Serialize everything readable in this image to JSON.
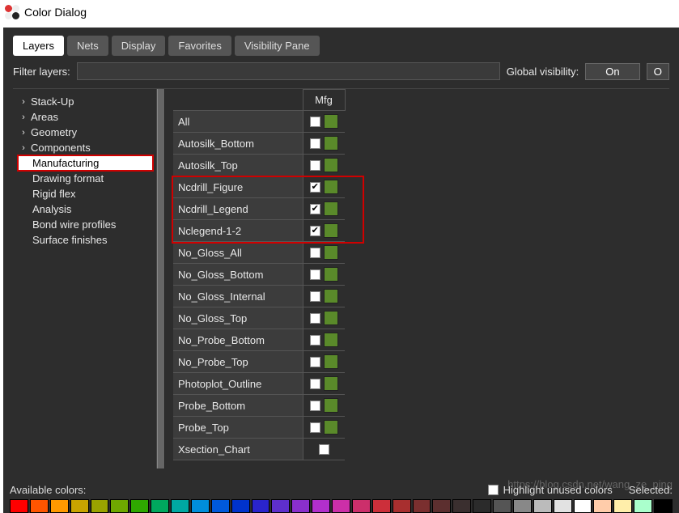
{
  "window": {
    "title": "Color Dialog"
  },
  "tabs": [
    {
      "label": "Layers",
      "active": true
    },
    {
      "label": "Nets"
    },
    {
      "label": "Display"
    },
    {
      "label": "Favorites"
    },
    {
      "label": "Visibility Pane"
    }
  ],
  "filter": {
    "label": "Filter layers:",
    "value": ""
  },
  "global_visibility": {
    "label": "Global visibility:",
    "button": "On"
  },
  "tree": {
    "items": [
      {
        "label": "Stack-Up",
        "expandable": true
      },
      {
        "label": "Areas",
        "expandable": true
      },
      {
        "label": "Geometry",
        "expandable": true
      },
      {
        "label": "Components",
        "expandable": true
      },
      {
        "label": "Manufacturing",
        "expandable": false,
        "selected": true
      },
      {
        "label": "Drawing format",
        "expandable": false
      },
      {
        "label": "Rigid flex",
        "expandable": false
      },
      {
        "label": "Analysis",
        "expandable": false
      },
      {
        "label": "Bond wire profiles",
        "expandable": false
      },
      {
        "label": "Surface finishes",
        "expandable": false
      }
    ]
  },
  "grid": {
    "header_mfg": "Mfg",
    "rows": [
      {
        "name": "All",
        "checked": false,
        "swatch": true
      },
      {
        "name": "Autosilk_Bottom",
        "checked": false,
        "swatch": true
      },
      {
        "name": "Autosilk_Top",
        "checked": false,
        "swatch": true
      },
      {
        "name": "Ncdrill_Figure",
        "checked": true,
        "swatch": true
      },
      {
        "name": "Ncdrill_Legend",
        "checked": true,
        "swatch": true
      },
      {
        "name": "Nclegend-1-2",
        "checked": true,
        "swatch": true
      },
      {
        "name": "No_Gloss_All",
        "checked": false,
        "swatch": true
      },
      {
        "name": "No_Gloss_Bottom",
        "checked": false,
        "swatch": true
      },
      {
        "name": "No_Gloss_Internal",
        "checked": false,
        "swatch": true
      },
      {
        "name": "No_Gloss_Top",
        "checked": false,
        "swatch": true
      },
      {
        "name": "No_Probe_Bottom",
        "checked": false,
        "swatch": true
      },
      {
        "name": "No_Probe_Top",
        "checked": false,
        "swatch": true
      },
      {
        "name": "Photoplot_Outline",
        "checked": false,
        "swatch": true
      },
      {
        "name": "Probe_Bottom",
        "checked": false,
        "swatch": true
      },
      {
        "name": "Probe_Top",
        "checked": false,
        "swatch": true
      },
      {
        "name": "Xsection_Chart",
        "checked": false,
        "swatch": false
      }
    ]
  },
  "bottom": {
    "available_label": "Available colors:",
    "highlight_label": "Highlight unused colors",
    "selected_label": "Selected:"
  },
  "watermark": "https://blog.csdn.net/wang_ze_ping",
  "palette": [
    "#ff0000",
    "#ff5500",
    "#ff9900",
    "#c9a400",
    "#9aa300",
    "#6fa800",
    "#2fa800",
    "#00a85e",
    "#00a8a2",
    "#008edb",
    "#0059db",
    "#0033cc",
    "#2a24cc",
    "#5e2fcc",
    "#8a2fcc",
    "#b22fcc",
    "#cc2fa8",
    "#cc2f6b",
    "#cc2f3a",
    "#a82f2f",
    "#7a2f2f",
    "#5c2f2f",
    "#3a2f2f",
    "#2b2b2b",
    "#555555",
    "#888888",
    "#bbbbbb",
    "#e2e2e2",
    "#ffffff",
    "#ffccaa",
    "#ffeeaa",
    "#aaffcc",
    "#000000"
  ]
}
